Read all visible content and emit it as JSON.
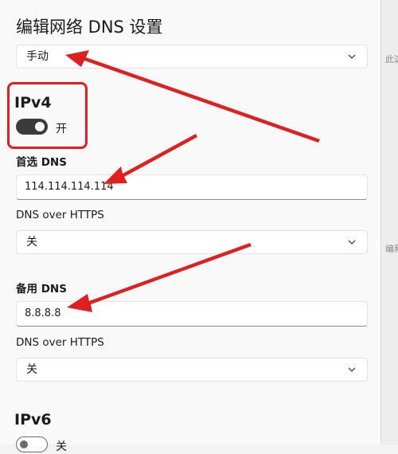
{
  "dialog": {
    "title": "编辑网络 DNS 设置",
    "mode_dropdown": {
      "value": "手动"
    }
  },
  "ipv4": {
    "heading": "IPv4",
    "toggle": {
      "state": "on",
      "label": "开"
    },
    "preferred_dns": {
      "label": "首选 DNS",
      "value": "114.114.114.114",
      "doh_label": "DNS over HTTPS",
      "doh_value": "关"
    },
    "alternate_dns": {
      "label": "备用 DNS",
      "value": "8.8.8.8",
      "doh_label": "DNS over HTTPS",
      "doh_value": "关"
    }
  },
  "ipv6": {
    "heading": "IPv6",
    "toggle": {
      "state": "off",
      "label": "关"
    }
  },
  "background_edge": {
    "fragments": [
      "此选",
      "编和"
    ]
  },
  "annotations": {
    "highlight_color": "#e02020",
    "arrow_color": "#e02020"
  }
}
